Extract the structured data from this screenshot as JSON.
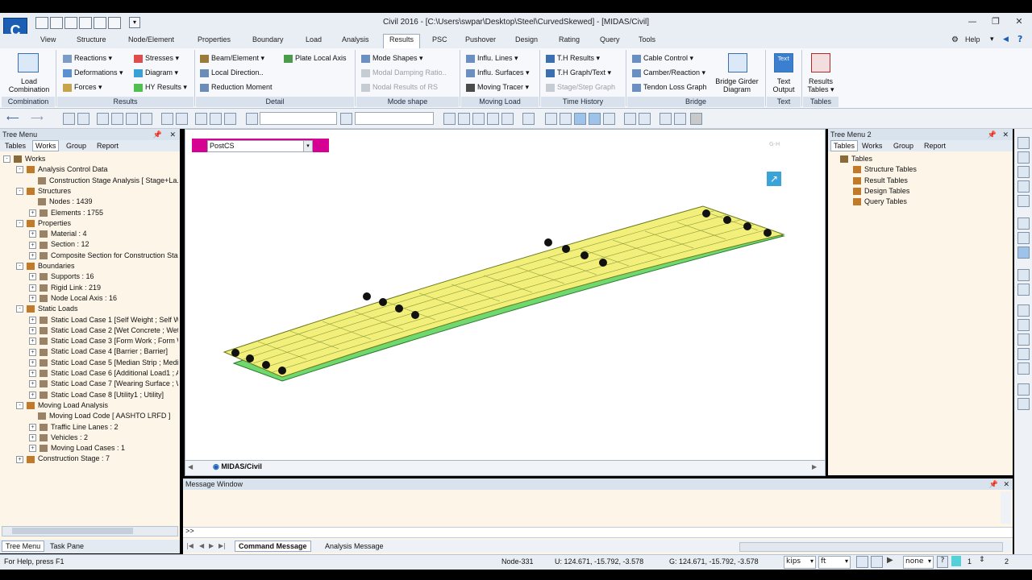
{
  "window": {
    "title": "Civil 2016 - [C:\\Users\\swpar\\Desktop\\Steel\\CurvedSkewed] - [MIDAS/Civil]",
    "help_label": "Help",
    "logo_letter": "C"
  },
  "ribbon_tabs": [
    "View",
    "Structure",
    "Node/Element",
    "Properties",
    "Boundary",
    "Load",
    "Analysis",
    "Results",
    "PSC",
    "Pushover",
    "Design",
    "Rating",
    "Query",
    "Tools"
  ],
  "active_tab": "Results",
  "ribbon": {
    "combination": {
      "btn": "Load Combination",
      "btn_line1": "Load",
      "btn_line2": "Combination",
      "label": "Combination"
    },
    "results": {
      "label": "Results",
      "items": [
        "Reactions",
        "Deformations",
        "Forces",
        "Stresses",
        "Diagram",
        "HY Results"
      ]
    },
    "detail": {
      "label": "Detail",
      "items": [
        "Beam/Element",
        "Local Direction..",
        "Reduction Moment",
        "Plate Local Axis"
      ]
    },
    "mode_shape": {
      "label": "Mode shape",
      "items": [
        "Mode Shapes",
        "Modal Damping Ratio..",
        "Nodal Results of RS"
      ]
    },
    "moving_load": {
      "label": "Moving Load",
      "items": [
        "Influ. Lines",
        "Influ. Surfaces",
        "Moving Tracer"
      ]
    },
    "time_history": {
      "label": "Time History",
      "items": [
        "T.H Results",
        "T.H Graph/Text",
        "Stage/Step Graph"
      ]
    },
    "bridge": {
      "label": "Bridge",
      "items": [
        "Cable Control",
        "Camber/Reaction",
        "Tendon Loss Graph"
      ],
      "big_btn_line1": "Bridge Girder",
      "big_btn_line2": "Diagram"
    },
    "text": {
      "label": "Text",
      "btn_line1": "Text",
      "btn_line2": "Output",
      "icon_text": "Text"
    },
    "tables": {
      "label": "Tables",
      "btn_line1": "Results",
      "btn_line2": "Tables"
    }
  },
  "left_panel": {
    "title": "Tree Menu",
    "tabs": [
      "Tables",
      "Works",
      "Group",
      "Report"
    ],
    "active_tab": "Works",
    "tree": [
      {
        "label": "Works",
        "level": 0,
        "tw": "-"
      },
      {
        "label": "Analysis Control Data",
        "level": 1,
        "tw": "-"
      },
      {
        "label": "Construction Stage Analysis [ Stage+La...",
        "level": 2,
        "tw": ""
      },
      {
        "label": "Structures",
        "level": 1,
        "tw": "-"
      },
      {
        "label": "Nodes : 1439",
        "level": 2,
        "tw": ""
      },
      {
        "label": "Elements : 1755",
        "level": 2,
        "tw": "+"
      },
      {
        "label": "Properties",
        "level": 1,
        "tw": "-"
      },
      {
        "label": "Material : 4",
        "level": 2,
        "tw": "+"
      },
      {
        "label": "Section : 12",
        "level": 2,
        "tw": "+"
      },
      {
        "label": "Composite Section for Construction Stage...",
        "level": 2,
        "tw": "+"
      },
      {
        "label": "Boundaries",
        "level": 1,
        "tw": "-"
      },
      {
        "label": "Supports : 16",
        "level": 2,
        "tw": "+"
      },
      {
        "label": "Rigid Link : 219",
        "level": 2,
        "tw": "+"
      },
      {
        "label": "Node Local Axis : 16",
        "level": 2,
        "tw": "+"
      },
      {
        "label": "Static Loads",
        "level": 1,
        "tw": "-"
      },
      {
        "label": "Static Load Case 1 [Self Weight ; Self We...",
        "level": 2,
        "tw": "+"
      },
      {
        "label": "Static Load Case 2 [Wet Concrete ; Wet C...",
        "level": 2,
        "tw": "+"
      },
      {
        "label": "Static Load Case 3 [Form Work ; Form W...",
        "level": 2,
        "tw": "+"
      },
      {
        "label": "Static Load Case 4 [Barrier ; Barrier]",
        "level": 2,
        "tw": "+"
      },
      {
        "label": "Static Load Case 5 [Median Strip ; Median...",
        "level": 2,
        "tw": "+"
      },
      {
        "label": "Static Load Case 6 [Additional Load1 ; Ad...",
        "level": 2,
        "tw": "+"
      },
      {
        "label": "Static Load Case 7 [Wearing Surface ; W...",
        "level": 2,
        "tw": "+"
      },
      {
        "label": "Static Load Case 8 [Utility1 ; Utility]",
        "level": 2,
        "tw": "+"
      },
      {
        "label": "Moving Load Analysis",
        "level": 1,
        "tw": "-"
      },
      {
        "label": "Moving Load Code [ AASHTO LRFD ]",
        "level": 2,
        "tw": ""
      },
      {
        "label": "Traffic Line Lanes : 2",
        "level": 2,
        "tw": "+"
      },
      {
        "label": "Vehicles : 2",
        "level": 2,
        "tw": "+"
      },
      {
        "label": "Moving Load Cases : 1",
        "level": 2,
        "tw": "+"
      },
      {
        "label": "Construction Stage : 7",
        "level": 1,
        "tw": "+"
      }
    ],
    "bottom_tabs": [
      "Tree Menu",
      "Task Pane"
    ]
  },
  "viewport": {
    "stage_select": "PostCS",
    "watermark": "G-H",
    "tab_label": "MIDAS/Civil"
  },
  "right_panel": {
    "title": "Tree Menu 2",
    "tabs": [
      "Tables",
      "Works",
      "Group",
      "Report"
    ],
    "active_tab": "Tables",
    "tree": [
      {
        "label": "Tables",
        "level": 0
      },
      {
        "label": "Structure Tables",
        "level": 1
      },
      {
        "label": "Result Tables",
        "level": 1
      },
      {
        "label": "Design Tables",
        "level": 1
      },
      {
        "label": "Query Tables",
        "level": 1
      }
    ]
  },
  "message": {
    "title": "Message Window",
    "prompt": ">>",
    "tabs": [
      "Command Message",
      "Analysis Message"
    ]
  },
  "status": {
    "help": "For Help, press F1",
    "node": "Node-331",
    "u_coord": "U: 124.671, -15.792, -3.578",
    "g_coord": "G: 124.671, -15.792, -3.578",
    "force_unit": "kips",
    "length_unit": "ft",
    "none_label": "none",
    "page_a": "1",
    "page_b": "2"
  },
  "colors": {
    "deck": "#f2f07a",
    "girder_green": "#4fd84f",
    "girder_pink": "#d42b8a",
    "highlight": "#d60093"
  }
}
